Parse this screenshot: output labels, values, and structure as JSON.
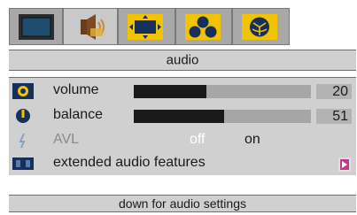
{
  "menu": {
    "tabs": [
      {
        "name": "picture",
        "icon": "tv-screen-icon"
      },
      {
        "name": "audio",
        "icon": "speaker-icon",
        "active": true
      },
      {
        "name": "screen",
        "icon": "screen-format-icon"
      },
      {
        "name": "features",
        "icon": "features-icon"
      },
      {
        "name": "installation",
        "icon": "installation-icon"
      }
    ]
  },
  "header": {
    "title": "audio"
  },
  "settings": {
    "volume": {
      "label": "volume",
      "value": "20",
      "level": 0.41
    },
    "balance": {
      "label": "balance",
      "value": "51",
      "level": 0.51
    },
    "avl": {
      "label": "AVL",
      "off_label": "off",
      "on_label": "on",
      "selected": "off"
    },
    "extended": {
      "label": "extended audio features"
    }
  },
  "footer": {
    "hint": "down for audio settings"
  },
  "colors": {
    "tab_icon_yellow": "#f2c300",
    "tab_icon_navy": "#16305c",
    "panel_bg": "#d0d0d0",
    "slider_fill": "#1a1a1a",
    "slider_track": "#a6a6a6",
    "selected_text": "#ffffff"
  }
}
